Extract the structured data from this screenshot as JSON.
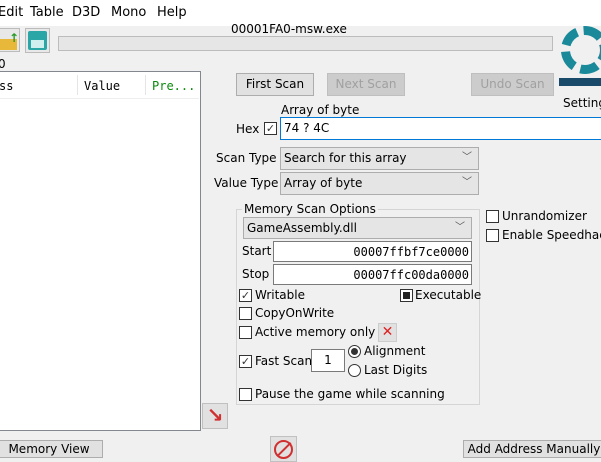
{
  "menu": [
    "Edit",
    "Table",
    "D3D",
    "Mono",
    "Help"
  ],
  "title": "00001FA0-msw.exe",
  "found_count": "0",
  "address_list": {
    "columns": [
      "ss",
      "Value",
      "Pre..."
    ]
  },
  "buttons": {
    "first_scan": "First Scan",
    "next_scan": "Next Scan",
    "undo_scan": "Undo Scan",
    "settings": "Settings",
    "memory_view": "Memory View",
    "add_address": "Add Address Manually"
  },
  "scan": {
    "value_label": "Array of byte",
    "hex_label": "Hex",
    "hex_checked": true,
    "value": "74 ? 4C",
    "scan_type_label": "Scan Type",
    "scan_type": "Search for this array",
    "value_type_label": "Value Type",
    "value_type": "Array of byte"
  },
  "memory_options": {
    "legend": "Memory Scan Options",
    "module": "GameAssembly.dll",
    "start_label": "Start",
    "start": "00007ffbf7ce0000",
    "stop_label": "Stop",
    "stop": "00007ffc00da0000",
    "writable": "Writable",
    "executable": "Executable",
    "copy_on_write": "CopyOnWrite",
    "active_memory": "Active memory only",
    "fast_scan": "Fast Scan",
    "fast_scan_value": "1",
    "alignment": "Alignment",
    "last_digits": "Last Digits",
    "pause": "Pause the game while scanning"
  },
  "extras": {
    "unrandomizer": "Unrandomizer",
    "speedhack": "Enable Speedhack"
  },
  "colors": {
    "logo": "#1a8a9a",
    "accent": "#0078d7",
    "stop": "#d03030"
  }
}
